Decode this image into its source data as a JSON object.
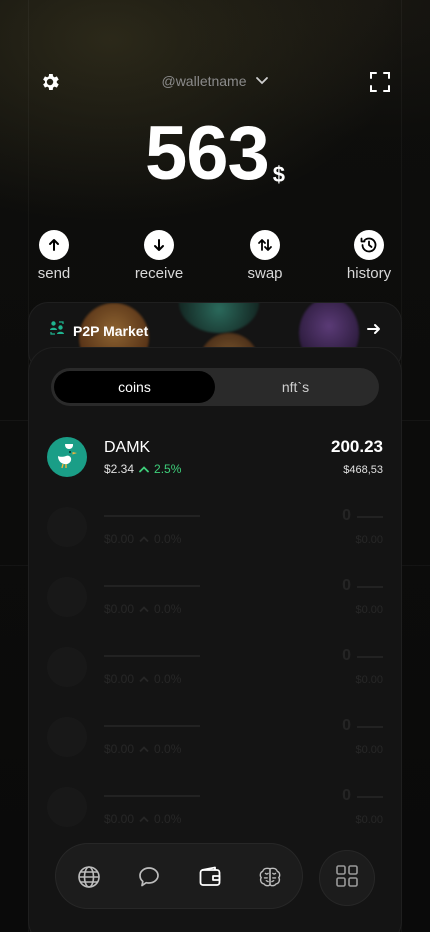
{
  "header": {
    "wallet_name": "@walletname",
    "icons": [
      "gear-icon",
      "chevron-down-icon",
      "scan-icon"
    ]
  },
  "balance": {
    "amount": "563",
    "currency": "$"
  },
  "actions": [
    {
      "label": "send",
      "icon": "arrow-up-icon"
    },
    {
      "label": "receive",
      "icon": "arrow-down-icon"
    },
    {
      "label": "swap",
      "icon": "swap-arrows-icon"
    },
    {
      "label": "history",
      "icon": "history-icon"
    }
  ],
  "p2p": {
    "title": "P2P Market",
    "icon": "p2p-users-icon",
    "arrow": "arrow-right-icon"
  },
  "tabs": {
    "coins": "coins",
    "nfts": "nft`s",
    "active": "coins"
  },
  "coins": [
    {
      "name": "DAMK",
      "price": "$2.34",
      "change": "2.5%",
      "amount": "200.23",
      "usd": "$468,53",
      "icon": "duck-icon",
      "color": "#1a9e87"
    }
  ],
  "placeholders": [
    {
      "price": "$0.00",
      "change": "0.0%",
      "amount": "0",
      "usd": "$0.00"
    },
    {
      "price": "$0.00",
      "change": "0.0%",
      "amount": "0",
      "usd": "$0.00"
    },
    {
      "price": "$0.00",
      "change": "0.0%",
      "amount": "0",
      "usd": "$0.00"
    },
    {
      "price": "$0.00",
      "change": "0.0%",
      "amount": "0",
      "usd": "$0.00"
    },
    {
      "price": "$0.00",
      "change": "0.0%",
      "amount": "0",
      "usd": "$0.00"
    }
  ],
  "nav": {
    "items": [
      "globe-icon",
      "chat-icon",
      "wallet-icon",
      "brain-icon"
    ],
    "active": "wallet-icon",
    "apps": "apps-grid-icon"
  },
  "colors": {
    "accent_green": "#3ecf7a",
    "coin_teal": "#1a9e87",
    "background": "#0b0b0b"
  }
}
